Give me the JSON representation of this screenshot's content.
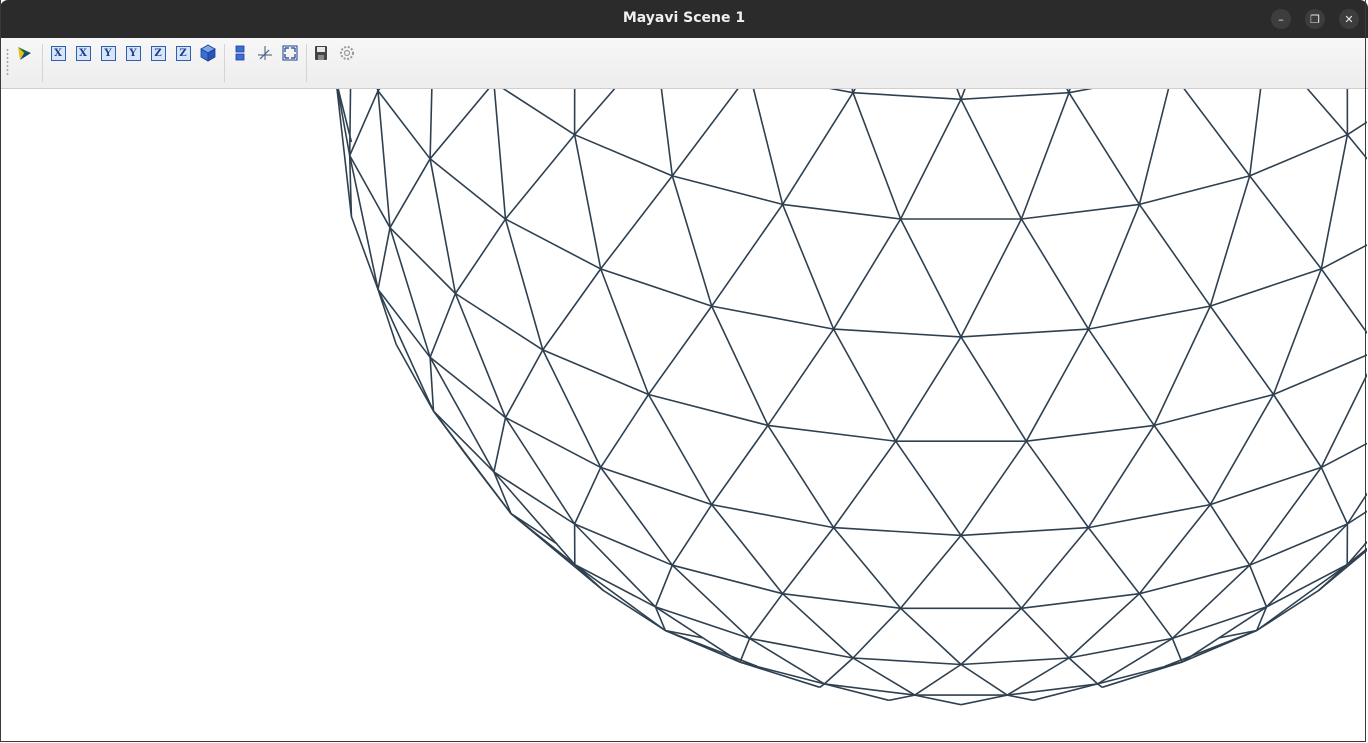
{
  "window": {
    "title": "Mayavi Scene 1",
    "controls": {
      "minimize": "–",
      "maximize": "❐",
      "close": "✕"
    }
  },
  "toolbar": {
    "items": [
      {
        "name": "mayavi-pipeline-icon",
        "label": ""
      },
      {
        "name": "view-x-plus-button",
        "label": "X"
      },
      {
        "name": "view-x-minus-button",
        "label": "X"
      },
      {
        "name": "view-y-plus-button",
        "label": "Y"
      },
      {
        "name": "view-y-minus-button",
        "label": "Y"
      },
      {
        "name": "view-z-plus-button",
        "label": "Z"
      },
      {
        "name": "view-z-minus-button",
        "label": "Z"
      },
      {
        "name": "isometric-view-icon",
        "label": ""
      },
      {
        "name": "parallel-projection-icon",
        "label": ""
      },
      {
        "name": "axes-indicator-icon",
        "label": ""
      },
      {
        "name": "full-screen-icon",
        "label": ""
      },
      {
        "name": "save-icon",
        "label": ""
      },
      {
        "name": "configure-scene-icon",
        "label": ""
      }
    ]
  },
  "scene": {
    "mesh_color": "#2f4050",
    "background": "#ffffff",
    "object": "wireframe triangulated sphere"
  },
  "colors": {
    "titlebar": "#2b2b2b",
    "toolbar": "#f0f0f0",
    "accent": "#2f5fb3"
  }
}
